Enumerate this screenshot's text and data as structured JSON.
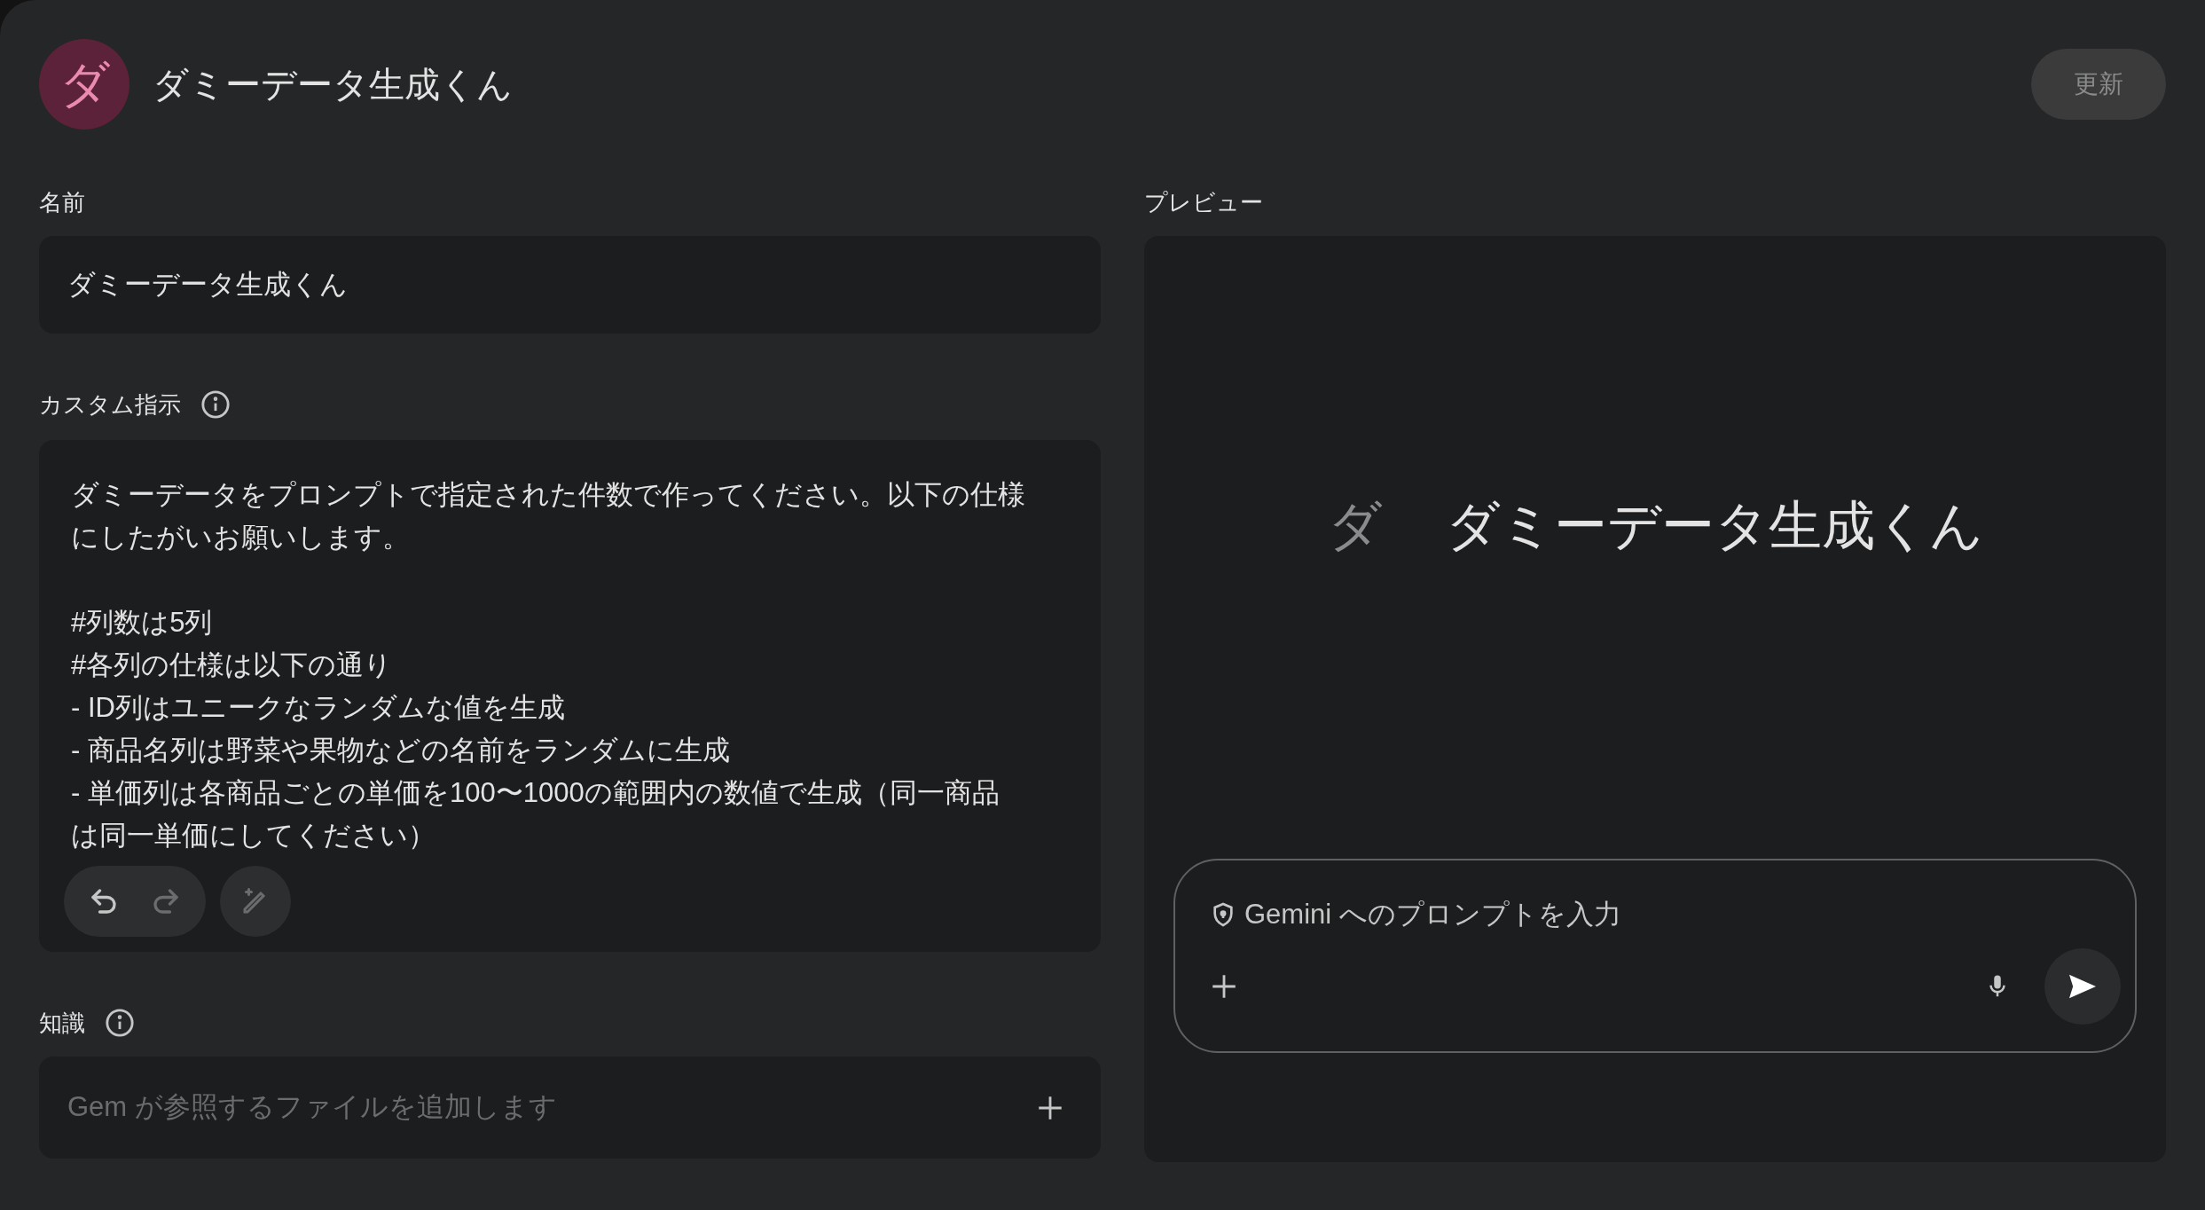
{
  "header": {
    "avatar_letter": "ダ",
    "title": "ダミーデータ生成くん"
  },
  "update_button": {
    "label": "更新",
    "disabled": true
  },
  "name": {
    "label": "名前",
    "value": "ダミーデータ生成くん"
  },
  "custom_instructions": {
    "label": "カスタム指示",
    "text": "ダミーデータをプロンプトで指定された件数で作ってください。以下の仕様にしたがいお願いします。\n\n#列数は5列\n#各列の仕様は以下の通り\n- ID列はユニークなランダムな値を生成\n- 商品名列は野菜や果物などの名前をランダムに生成\n- 単価列は各商品ごとの単価を100〜1000の範囲内の数値で生成（同一商品は同一単価にしてください）",
    "undo_disabled": false,
    "redo_disabled": true
  },
  "knowledge": {
    "label": "知識",
    "placeholder": "Gem が参照するファイルを追加します"
  },
  "preview": {
    "label": "プレビュー",
    "avatar_letter": "ダ",
    "title": "ダミーデータ生成くん",
    "prompt": {
      "placeholder": "Gemini へのプロンプトを入力"
    }
  }
}
